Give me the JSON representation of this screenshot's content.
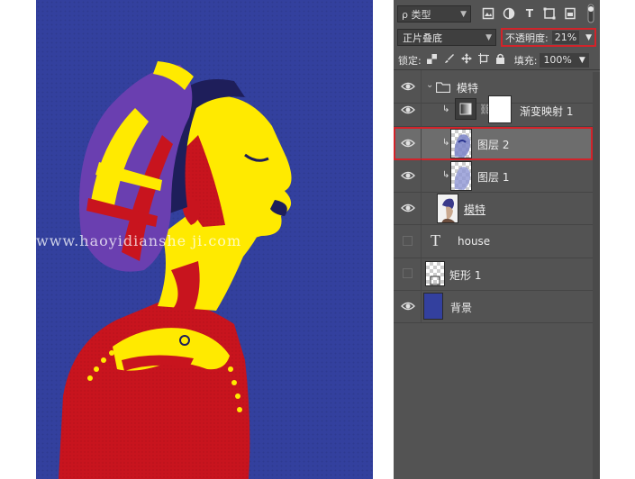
{
  "watermark": {
    "text": "www.haoyidianshe ji.com"
  },
  "panel": {
    "filter": {
      "label": "ρ 类型"
    },
    "blend_mode": "正片叠底",
    "opacity": {
      "label": "不透明度:",
      "value": "21%"
    },
    "lock": {
      "label": "锁定:"
    },
    "fill": {
      "label": "填充:",
      "value": "100%"
    },
    "layers": [
      {
        "name": "模特",
        "type": "group",
        "visible": true
      },
      {
        "name": "渐变映射 1",
        "type": "adjustment",
        "visible": true
      },
      {
        "name": "图层 2",
        "type": "pixel",
        "visible": true,
        "selected": true
      },
      {
        "name": "图层 1",
        "type": "pixel",
        "visible": true
      },
      {
        "name": "模特",
        "type": "smart-object",
        "visible": true
      },
      {
        "name": "house",
        "type": "text",
        "visible": false
      },
      {
        "name": "矩形 1",
        "type": "shape",
        "visible": false
      },
      {
        "name": "背景",
        "type": "fill",
        "visible": true
      }
    ]
  },
  "colors": {
    "art_blue": "#33409e",
    "art_yellow": "#ffea00",
    "art_red": "#c8141e",
    "art_navy": "#1e1e5a",
    "panel_bg": "#535353",
    "highlight": "#d2232a"
  },
  "icons": [
    "filter-image-icon",
    "filter-adjust-icon",
    "filter-text-icon",
    "filter-shape-icon",
    "filter-smart-icon",
    "filter-toggle-icon",
    "eye-icon",
    "folder-icon",
    "clip-arrow-icon",
    "link-icon",
    "text-layer-icon"
  ]
}
